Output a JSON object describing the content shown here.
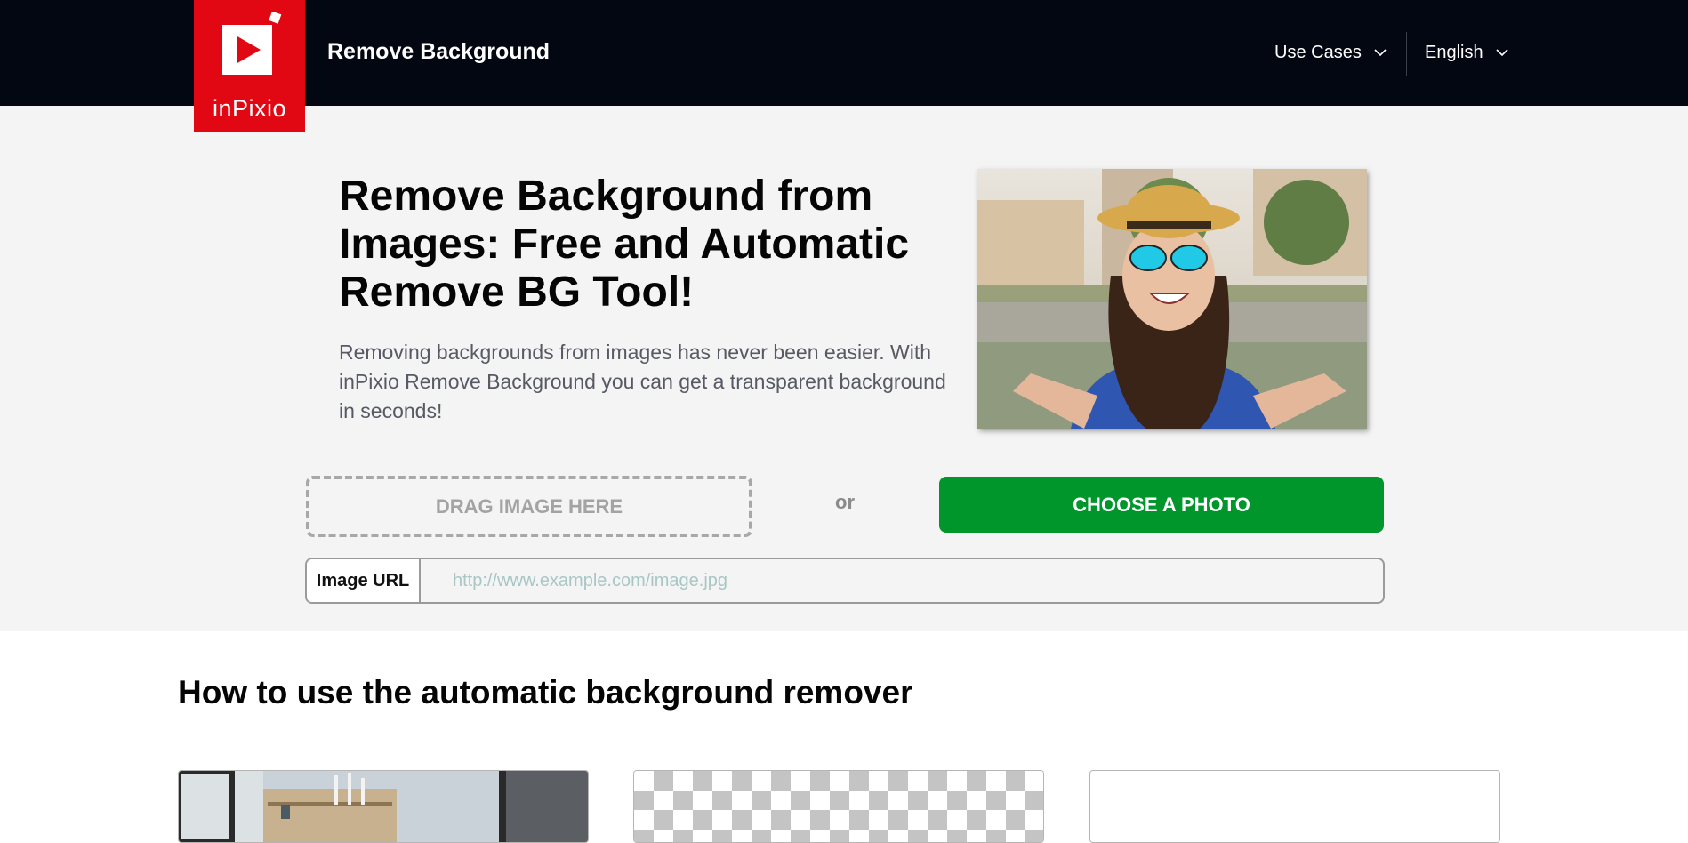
{
  "header": {
    "logo_text": "inPixio",
    "brand_title": "Remove Background",
    "nav": {
      "use_cases": "Use Cases",
      "language": "English"
    }
  },
  "hero": {
    "title": "Remove Background from Images: Free and Automatic Remove BG Tool!",
    "description": "Removing backgrounds from images has never been easier. With inPixio Remove Background you can get a transparent background in seconds!",
    "drop_zone_label": "DRAG IMAGE HERE",
    "or_label": "or",
    "choose_button_label": "CHOOSE A PHOTO",
    "url_label": "Image URL",
    "url_value": "",
    "url_placeholder": "http://www.example.com/image.jpg"
  },
  "howto": {
    "title": "How to use the automatic background remover"
  },
  "colors": {
    "header_bg": "#030712",
    "brand_red": "#e10713",
    "cta_green": "#00962c",
    "hero_bg": "#f4f4f4"
  },
  "icons": {
    "logo": "play-icon",
    "dropdown": "chevron-down-icon"
  }
}
